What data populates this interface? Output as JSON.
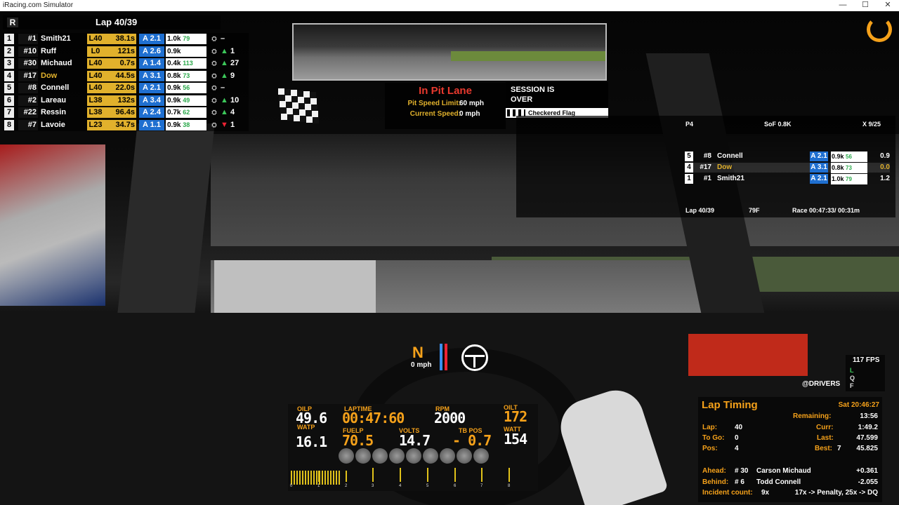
{
  "window": {
    "title": "iRacing.com Simulator",
    "minimize": "—",
    "maximize": "☐",
    "close": "✕"
  },
  "standings": {
    "class_badge": "R",
    "lap_label": "Lap 40/39",
    "rows": [
      {
        "pos": "1",
        "num": "#1",
        "name": "Smith21",
        "lap": "L40",
        "gap": "38.1s",
        "lic": "A 2.1",
        "ir": "1.0k",
        "ir_delta": "79",
        "chg": "–",
        "dir": "none"
      },
      {
        "pos": "2",
        "num": "#10",
        "name": "Ruff",
        "lap": "L0",
        "gap": "121s",
        "lic": "A 2.6",
        "ir": "0.9k",
        "ir_delta": "",
        "chg": "1",
        "dir": "up"
      },
      {
        "pos": "3",
        "num": "#30",
        "name": "Michaud",
        "lap": "L40",
        "gap": "0.7s",
        "lic": "A 1.4",
        "ir": "0.4k",
        "ir_delta": "113",
        "chg": "27",
        "dir": "up"
      },
      {
        "pos": "4",
        "num": "#17",
        "name": "Dow",
        "lap": "L40",
        "gap": "44.5s",
        "lic": "A 3.1",
        "ir": "0.8k",
        "ir_delta": "73",
        "chg": "9",
        "dir": "up",
        "highlight": true
      },
      {
        "pos": "5",
        "num": "#8",
        "name": "Connell",
        "lap": "L40",
        "gap": "22.0s",
        "lic": "A 2.1",
        "ir": "0.9k",
        "ir_delta": "56",
        "chg": "–",
        "dir": "none"
      },
      {
        "pos": "6",
        "num": "#2",
        "name": "Lareau",
        "lap": "L38",
        "gap": "132s",
        "lic": "A 3.4",
        "ir": "0.9k",
        "ir_delta": "49",
        "chg": "10",
        "dir": "up"
      },
      {
        "pos": "7",
        "num": "#22",
        "name": "Ressin",
        "lap": "L38",
        "gap": "96.4s",
        "lic": "A 2.4",
        "ir": "0.7k",
        "ir_delta": "62",
        "chg": "4",
        "dir": "up"
      },
      {
        "pos": "8",
        "num": "#7",
        "name": "Lavoie",
        "lap": "L23",
        "gap": "34.7s",
        "lic": "A 1.1",
        "ir": "0.9k",
        "ir_delta": "38",
        "chg": "1",
        "dir": "down"
      }
    ]
  },
  "pit_lane": {
    "title": "In Pit Lane",
    "limit_label": "Pit Speed Limit:",
    "limit_value": "60 mph",
    "current_label": "Current Speed:",
    "current_value": "0 mph"
  },
  "session": {
    "line1": "SESSION IS",
    "line2": "OVER",
    "flag_text": "Checkered Flag"
  },
  "relative": {
    "position": "P4",
    "sof": "SoF 0.8K",
    "incidents": "X 9/25",
    "rows": [
      {
        "pos": "5",
        "num": "#8",
        "name": "Connell",
        "lic": "A 2.1",
        "ir": "0.9k",
        "ir_delta": "56",
        "gap": "0.9",
        "is_player": false
      },
      {
        "pos": "4",
        "num": "#17",
        "name": "Dow",
        "lic": "A 3.1",
        "ir": "0.8k",
        "ir_delta": "73",
        "gap": "0.0",
        "is_player": true
      },
      {
        "pos": "1",
        "num": "#1",
        "name": "Smith21",
        "lic": "A 2.1",
        "ir": "1.0k",
        "ir_delta": "79",
        "gap": "1.2",
        "is_player": false
      }
    ],
    "lap": "Lap 40/39",
    "temp": "79F",
    "race_time": "Race 00:47:33/ 00:31m"
  },
  "center": {
    "gear": "N",
    "speed": "0 mph"
  },
  "dash": {
    "oilp_label": "OILP",
    "oilp": "49.6",
    "laptime_label": "LAPTIME",
    "laptime": "00:47:60",
    "rpm_label": "RPM",
    "rpm": "2000",
    "oilt_label": "OILT",
    "oilt": "172",
    "watp_label": "WATP",
    "watp": "16.1",
    "fuelp_label": "FUELP",
    "fuelp": "70.5",
    "volts_label": "VOLTS",
    "volts": "14.7",
    "tbpos_label": "TB POS",
    "tbpos": "- 0.7",
    "watt_label": "WATT",
    "watt": "154",
    "rpm_ticks": [
      "0",
      "1",
      "2",
      "3",
      "4",
      "5",
      "6",
      "7",
      "8"
    ],
    "rpm_fill_fraction": 0.21
  },
  "fps": {
    "value": "117 FPS",
    "l": "L",
    "q": "Q",
    "f": "F"
  },
  "drivers_label": "@DRIVERS",
  "lap_timing": {
    "title": "Lap Timing",
    "clock": "Sat 20:46:27",
    "remaining_label": "Remaining:",
    "remaining": "13:56",
    "lap_label": "Lap:",
    "lap": "40",
    "curr_label": "Curr:",
    "curr": "1:49.2",
    "togo_label": "To Go:",
    "togo": "0",
    "last_label": "Last:",
    "last": "47.599",
    "pos_label": "Pos:",
    "pos": "4",
    "best_label": "Best:",
    "best_lap": "7",
    "best": "45.825",
    "ahead_label": "Ahead:",
    "ahead_num": "# 30",
    "ahead_name": "Carson Michaud",
    "ahead_gap": "+0.361",
    "behind_label": "Behind:",
    "behind_num": "# 6",
    "behind_name": "Todd Connell",
    "behind_gap": "-2.055",
    "incident_label": "Incident count:",
    "incident": "9x",
    "incident_rule": "17x -> Penalty, 25x -> DQ"
  },
  "colors": {
    "accent": "#f5a11a",
    "license_blue": "#1f6fd0",
    "gap_yellow": "#e1b12c",
    "pit_red": "#e8392e"
  }
}
